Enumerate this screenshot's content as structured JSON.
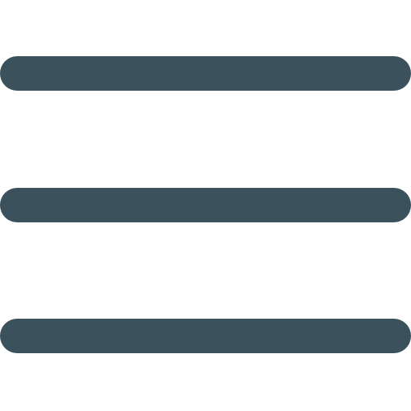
{
  "icon": {
    "name": "hamburger-menu-icon",
    "bar_color": "#3b525c",
    "background_color": "#ffffff",
    "bar_count": 3
  }
}
